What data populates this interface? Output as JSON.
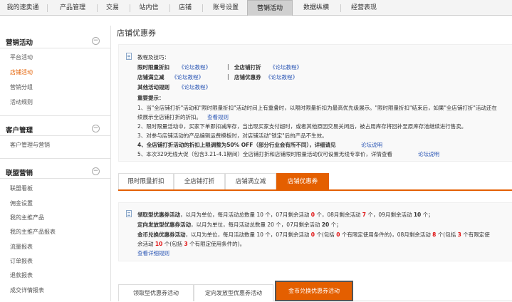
{
  "topnav": {
    "tabs": [
      "我的速卖通",
      "产品管理",
      "交易",
      "站内信",
      "店铺",
      "账号设置",
      "营销活动",
      "数据纵横",
      "经营表现"
    ],
    "active_index": 6
  },
  "sidebar": {
    "sections": [
      {
        "title": "营销活动",
        "toggle": "−",
        "items": [
          "平台活动",
          "店铺活动",
          "营销分组",
          "活动规则"
        ],
        "active_item": 1
      },
      {
        "title": "客户管理",
        "toggle": "−",
        "items": [
          "客户管理与营销"
        ]
      },
      {
        "title": "联盟营销",
        "toggle": "−",
        "items": [
          "联盟看板",
          "佣金设置",
          "我的主推产品",
          "我的主推产品报表",
          "流量报表",
          "订单报表",
          "退款报表",
          "成交详情报表"
        ]
      }
    ]
  },
  "page_title": "店铺优惠券",
  "tips": {
    "header": "教程及技巧：",
    "rows": [
      {
        "name": "限时限量折扣",
        "link": "《论坛教程》"
      },
      {
        "name": "全店铺打折",
        "link": "《论坛教程》"
      },
      {
        "name": "店铺满立减",
        "link": "《论坛教程》"
      },
      {
        "name": "店铺优惠券",
        "link": "《论坛教程》"
      },
      {
        "name": "其他活动规则",
        "link": "《论坛教程》"
      }
    ],
    "important_title": "重要提示：",
    "n1a": "1、当\"全店铺打折\"活动和\"限时限量折扣\"活动时间上有重叠时，以限时限量折扣为最高优先级展示。\"限时限量折扣\"结束后，如果\"全店铺打折\"活动还在",
    "n1b": "续展示全店铺打折的折扣。",
    "n1_link": "查看规则",
    "n2": "2、限时限量活动中，买家下单即扣减库存，当出现买家支付超时，或者其他原因交易关闭后，被占用库存将回补至原库存池继续进行售卖。",
    "n3": "3、对参与店铺活动的产品编辑运费模板时，对店铺活动\"锁定\"后的产品不生效。",
    "n4": "4、全店铺打折活动的折扣上限调整为50% OFF（部分行业会有所不同），详细请见",
    "n4_link": "论坛说明",
    "n5": "5、本次329无线大促（包含3.21-4.1期间）全店铺打折和店铺限时限量活动仅可设置无线专享价，详情查看",
    "n5_link": "论坛说明"
  },
  "campaign_tabs": {
    "labels": [
      "限时限量折扣",
      "全店铺打折",
      "店铺满立减",
      "店铺优惠券"
    ],
    "active_index": 3
  },
  "coupon_info": {
    "l1_title": "领取型优惠券活动",
    "l1_text": "，以月为单位，每月活动总数量 10 个，07月剩余活动",
    "l1_v1": "0",
    "l1_m": "个，08月剩余活动",
    "l1_v2": "7",
    "l1_m2": "个，09月剩余活动",
    "l1_v3": "10",
    "l1_end": "个；",
    "l2_title": "定向发放型优惠券活动",
    "l2_text": "，以月为单位，每月活动总数量 20 个，07月剩余活动",
    "l2_v1": "20",
    "l2_end": "个；",
    "l3_title": "金币兑换优惠券活动",
    "l3_text": "，以月为单位，每月活动数量 10 个，07月剩余活动",
    "l3_v1": "0",
    "l3_m": "个(包括",
    "l3_v2": "0",
    "l3_m2": "个有限定使用条件的)，08月剩余活动",
    "l3_v3": "8",
    "l3_m3": "个(包括",
    "l3_v4": "3",
    "l3_end": "个有限定使",
    "l4_a": "余活动",
    "l4_v": "10",
    "l4_m": "个(包括",
    "l4_v2": "3",
    "l4_end": "个有限定使用条件的)。",
    "rule_link": "查看详细规则"
  },
  "coupon_tabs": {
    "labels": [
      "领取型优惠券活动",
      "定向发放型优惠券活动",
      "金币兑换优惠券活动"
    ],
    "active_index": 2
  },
  "colors": {
    "accent": "#e45f00",
    "link": "#2b56b5",
    "alert": "#e01010"
  }
}
